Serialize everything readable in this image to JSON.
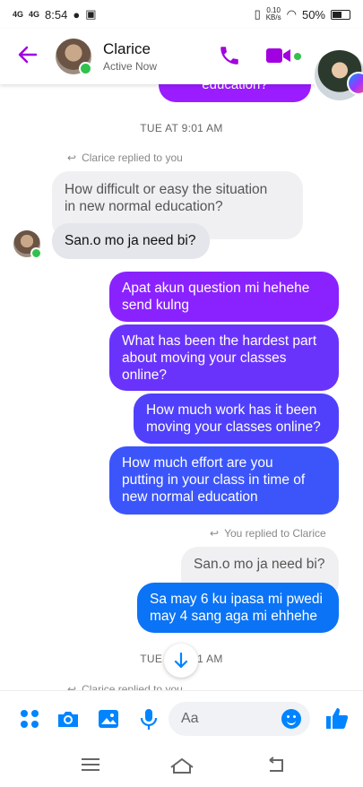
{
  "status": {
    "sig1": "4G",
    "sig2": "4G",
    "time": "8:54",
    "net_speed": "0.10",
    "net_unit": "KB/s",
    "battery": "50%"
  },
  "header": {
    "name": "Clarice",
    "status": "Active Now",
    "accent": "#a100e0"
  },
  "chat": {
    "partial_text": "education?",
    "timestamp1": "TUE AT 9:01 AM",
    "reply_note_1": "Clarice replied to you",
    "quoted_1": "How difficult or easy the situation\nin new normal education?",
    "incoming_1": "San.o mo ja need bi?",
    "out_1": "Apat akun question mi hehehe\nsend kulng",
    "out_2": "What has been the hardest part\nabout moving your classes\nonline?",
    "out_3": "How much work has it been\nmoving your classes online?",
    "out_4": "How much effort are you\nputting in your class in time of\nnew normal education",
    "reply_note_2": "You replied to Clarice",
    "quoted_2": "San.o mo ja need bi?",
    "out_5": "Sa may 6 ku ipasa mi pwedi\nmay 4  sang aga mi ehhehe",
    "timestamp2": "TUE AT 9:01 AM",
    "reply_note_3": "Clarice replied to you"
  },
  "composer": {
    "placeholder": "Aa",
    "accent": "#0084ff"
  },
  "colors": {
    "purple": "#9b1cff",
    "blue": "#3b5bfd",
    "brand_blue": "#0084ff"
  }
}
